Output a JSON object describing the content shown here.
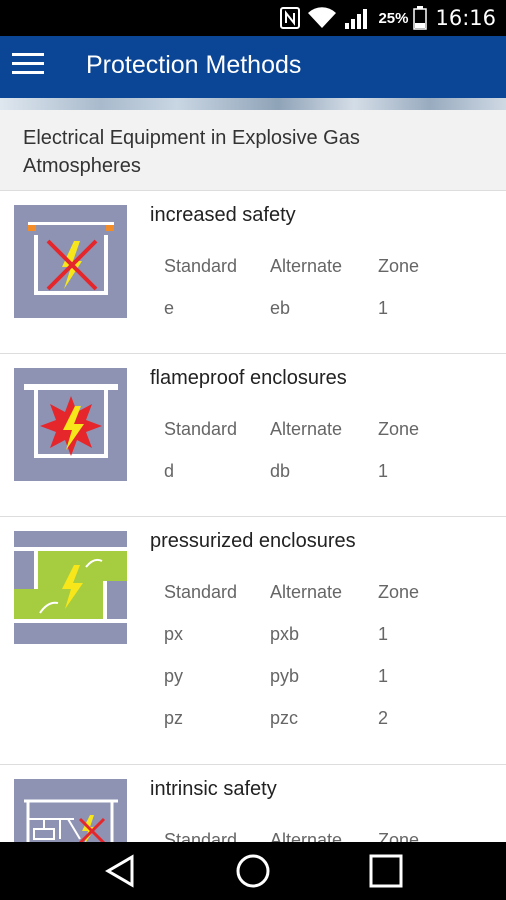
{
  "status": {
    "battery": "25%",
    "time": "16:16"
  },
  "appbar": {
    "title": "Protection Methods"
  },
  "subheader": {
    "text": "Electrical Equipment in Explosive Gas Atmospheres"
  },
  "items": [
    {
      "name": "increased safety",
      "headers": [
        "Standard",
        "Alternate",
        "Zone"
      ],
      "rows": [
        [
          "e",
          "eb",
          "1"
        ]
      ],
      "icon": "increased-safety-icon"
    },
    {
      "name": "flameproof enclosures",
      "headers": [
        "Standard",
        "Alternate",
        "Zone"
      ],
      "rows": [
        [
          "d",
          "db",
          "1"
        ]
      ],
      "icon": "flameproof-icon"
    },
    {
      "name": "pressurized enclosures",
      "headers": [
        "Standard",
        "Alternate",
        "Zone"
      ],
      "rows": [
        [
          "px",
          "pxb",
          "1"
        ],
        [
          "py",
          "pyb",
          "1"
        ],
        [
          "pz",
          "pzc",
          "2"
        ]
      ],
      "icon": "pressurized-icon"
    },
    {
      "name": "intrinsic safety",
      "headers": [
        "Standard",
        "Alternate",
        "Zone"
      ],
      "rows": [],
      "icon": "intrinsic-safety-icon"
    }
  ],
  "colors": {
    "appbar": "#0b4595",
    "tile": "#8e93b3",
    "accent_yellow": "#f7e71a",
    "accent_red": "#e5262b",
    "accent_green": "#a6cd3f"
  }
}
